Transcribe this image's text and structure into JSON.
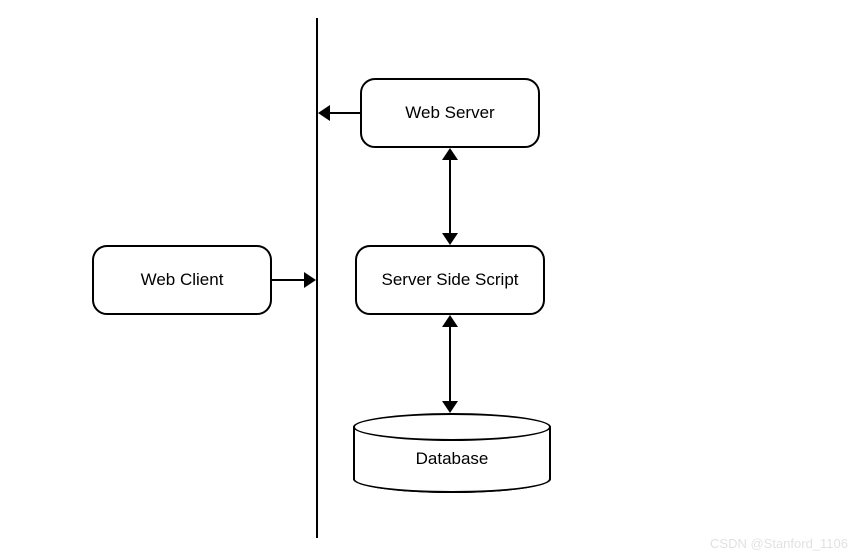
{
  "nodes": {
    "client": {
      "label": "Web Client"
    },
    "webserver": {
      "label": "Web Server"
    },
    "script": {
      "label": "Server Side Script"
    },
    "database": {
      "label": "Database"
    }
  },
  "watermark": "CSDN @Stanford_1106"
}
